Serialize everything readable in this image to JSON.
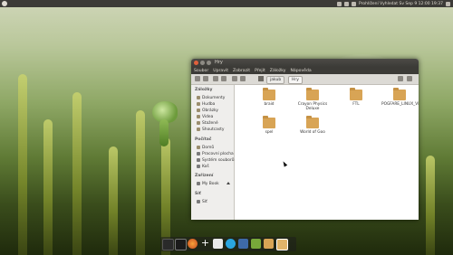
{
  "top_panel": {
    "status_text": "Prohlížení  Vyhledat  Sv  Sep 9 12:00  19:37"
  },
  "window": {
    "title": "Hry",
    "menu": [
      "Soubor",
      "Upravit",
      "Zobrazit",
      "Přejít",
      "Záložky",
      "Nápověda"
    ],
    "path": [
      "jakub",
      "Hry"
    ]
  },
  "sidebar": {
    "sections": [
      {
        "heading": "Záložky",
        "items": [
          "Dokumenty",
          "Hudba",
          "Obrázky",
          "Videa",
          "Stažené",
          "Shoutcasty"
        ]
      },
      {
        "heading": "Počítač",
        "items": [
          "Domů",
          "Pracovní plocha",
          "Systém souborů",
          "Koš"
        ]
      },
      {
        "heading": "Zařízení",
        "items": [
          "My Book"
        ]
      },
      {
        "heading": "Síť",
        "items": [
          "Síť"
        ]
      }
    ]
  },
  "folders": [
    {
      "label": "braid"
    },
    {
      "label": "Crayon Physics Deluxe"
    },
    {
      "label": "FTL"
    },
    {
      "label": "POGFARE_LINUX_VR_Demo"
    },
    {
      "label": "spel"
    },
    {
      "label": "World of Goo"
    }
  ],
  "dock": {
    "label": "Hry"
  },
  "colors": {
    "panel": "#3c3b37",
    "folder": "#d8a455",
    "close_button": "#e0603c"
  }
}
